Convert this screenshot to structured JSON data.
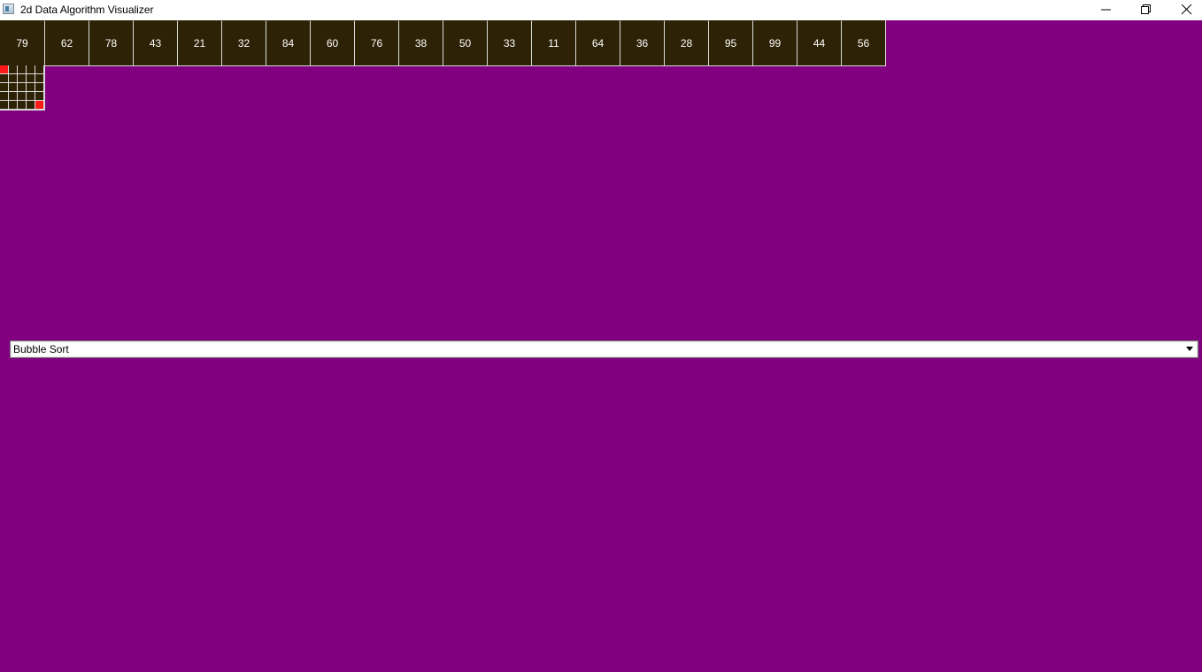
{
  "window": {
    "title": "2d Data Algorithm Visualizer",
    "icon": "app-window-icon",
    "controls": [
      "minimize-icon",
      "restore-icon",
      "close-icon"
    ]
  },
  "array": {
    "values": [
      "79",
      "62",
      "78",
      "43",
      "21",
      "32",
      "84",
      "60",
      "76",
      "38",
      "50",
      "33",
      "11",
      "64",
      "36",
      "28",
      "95",
      "99",
      "44",
      "56"
    ]
  },
  "grid": {
    "rows": 5,
    "cols": 5,
    "highlighted": [
      [
        0,
        0
      ],
      [
        4,
        4
      ]
    ]
  },
  "algorithm_selector": {
    "selected": "Bubble Sort",
    "icon": "chevron-down-icon"
  },
  "colors": {
    "background": "#800080",
    "cell": "#2e2206",
    "cell_border": "#d9d9d9",
    "highlight": "#ff1a1a"
  }
}
